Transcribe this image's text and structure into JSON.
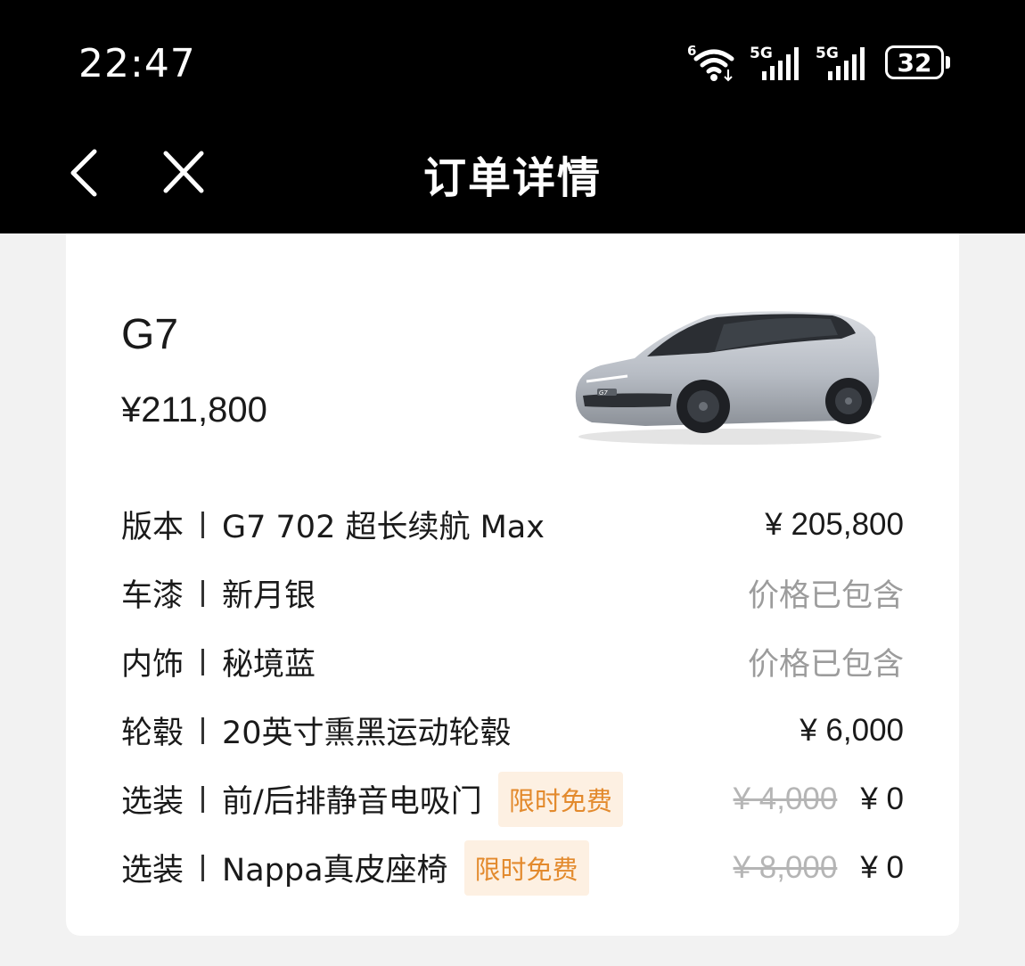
{
  "status_bar": {
    "time": "22:47",
    "wifi_badge": "6",
    "sim1_label": "5G",
    "sim2_label": "5G",
    "battery": "32"
  },
  "nav": {
    "title": "订单详情",
    "back_icon": "chevron-left-icon",
    "close_icon": "close-icon"
  },
  "order": {
    "model": "G7",
    "total_price": "¥211,800",
    "car_badge_text": "G7",
    "items": [
      {
        "label": "版本",
        "value": "G7 702 超长续航 Max",
        "price": "¥ 205,800"
      },
      {
        "label": "车漆",
        "value": "新月银",
        "price": "价格已包含"
      },
      {
        "label": "内饰",
        "value": "秘境蓝",
        "price": "价格已包含"
      },
      {
        "label": "轮毂",
        "value": "20英寸熏黑运动轮毂",
        "price": "¥ 6,000"
      },
      {
        "label": "选装",
        "value": "前/后排静音电吸门",
        "badge": "限时免费",
        "original_price": "¥ 4,000",
        "price": "¥ 0"
      },
      {
        "label": "选装",
        "value": "Nappa真皮座椅",
        "badge": "限时免费",
        "original_price": "¥ 8,000",
        "price": "¥ 0"
      }
    ]
  },
  "colors": {
    "badge_bg": "#fdf0e2",
    "badge_text": "#e38a2d",
    "muted_text": "#9c9c9c",
    "strike_text": "#b5b5b5"
  }
}
